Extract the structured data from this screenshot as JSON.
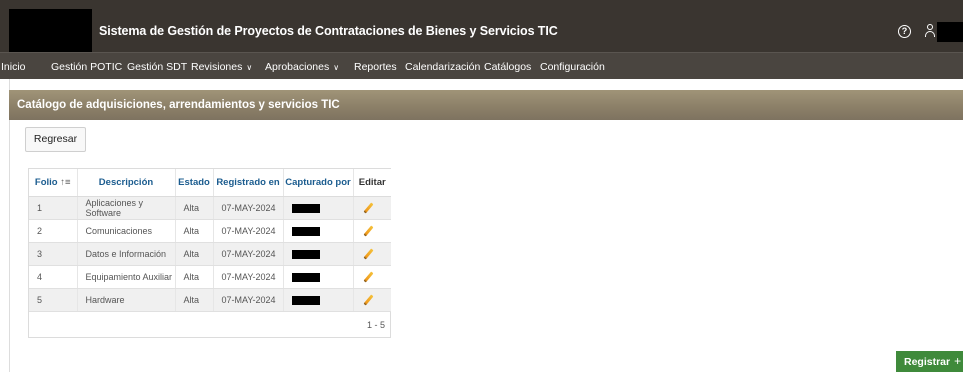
{
  "header": {
    "title": "Sistema de Gestión de Proyectos de Contrataciones de Bienes y Servicios TIC",
    "help_icon": "?",
    "icons": {
      "help": "help-circle-icon",
      "user": "user-icon"
    }
  },
  "nav": {
    "items": [
      {
        "label": "Inicio",
        "dropdown": false
      },
      {
        "label": "Gestión POTIC",
        "dropdown": false
      },
      {
        "label": "Gestión SDT",
        "dropdown": false
      },
      {
        "label": "Revisiones",
        "dropdown": true
      },
      {
        "label": "Aprobaciones",
        "dropdown": true
      },
      {
        "label": "Reportes",
        "dropdown": false
      },
      {
        "label": "Calendarización",
        "dropdown": false
      },
      {
        "label": "Catálogos",
        "dropdown": false
      },
      {
        "label": "Configuración",
        "dropdown": false
      }
    ],
    "chevron": "∨"
  },
  "region": {
    "title": "Catálogo de adquisiciones, arrendamientos y servicios TIC"
  },
  "buttons": {
    "regresar": "Regresar",
    "registrar": "Registrar",
    "registrar_plus": "+"
  },
  "table": {
    "columns": {
      "folio": "Folio",
      "folio_sort": "↑≡",
      "descripcion": "Descripción",
      "estado": "Estado",
      "registrado": "Registrado en",
      "capturado": "Capturado por",
      "editar": "Editar"
    },
    "rows": [
      {
        "folio": "1",
        "descripcion": "Aplicaciones y Software",
        "estado": "Alta",
        "registrado": "07-MAY-2024"
      },
      {
        "folio": "2",
        "descripcion": "Comunicaciones",
        "estado": "Alta",
        "registrado": "07-MAY-2024"
      },
      {
        "folio": "3",
        "descripcion": "Datos e Información",
        "estado": "Alta",
        "registrado": "07-MAY-2024"
      },
      {
        "folio": "4",
        "descripcion": "Equipamiento Auxiliar",
        "estado": "Alta",
        "registrado": "07-MAY-2024"
      },
      {
        "folio": "5",
        "descripcion": "Hardware",
        "estado": "Alta",
        "registrado": "07-MAY-2024"
      }
    ],
    "pagination": "1 - 5"
  },
  "colors": {
    "topbar": "#3a3530",
    "navbar": "#4a4540",
    "region_header": "#8c8068",
    "link_header": "#1b5c8f",
    "primary_button": "#3f8a3b"
  }
}
